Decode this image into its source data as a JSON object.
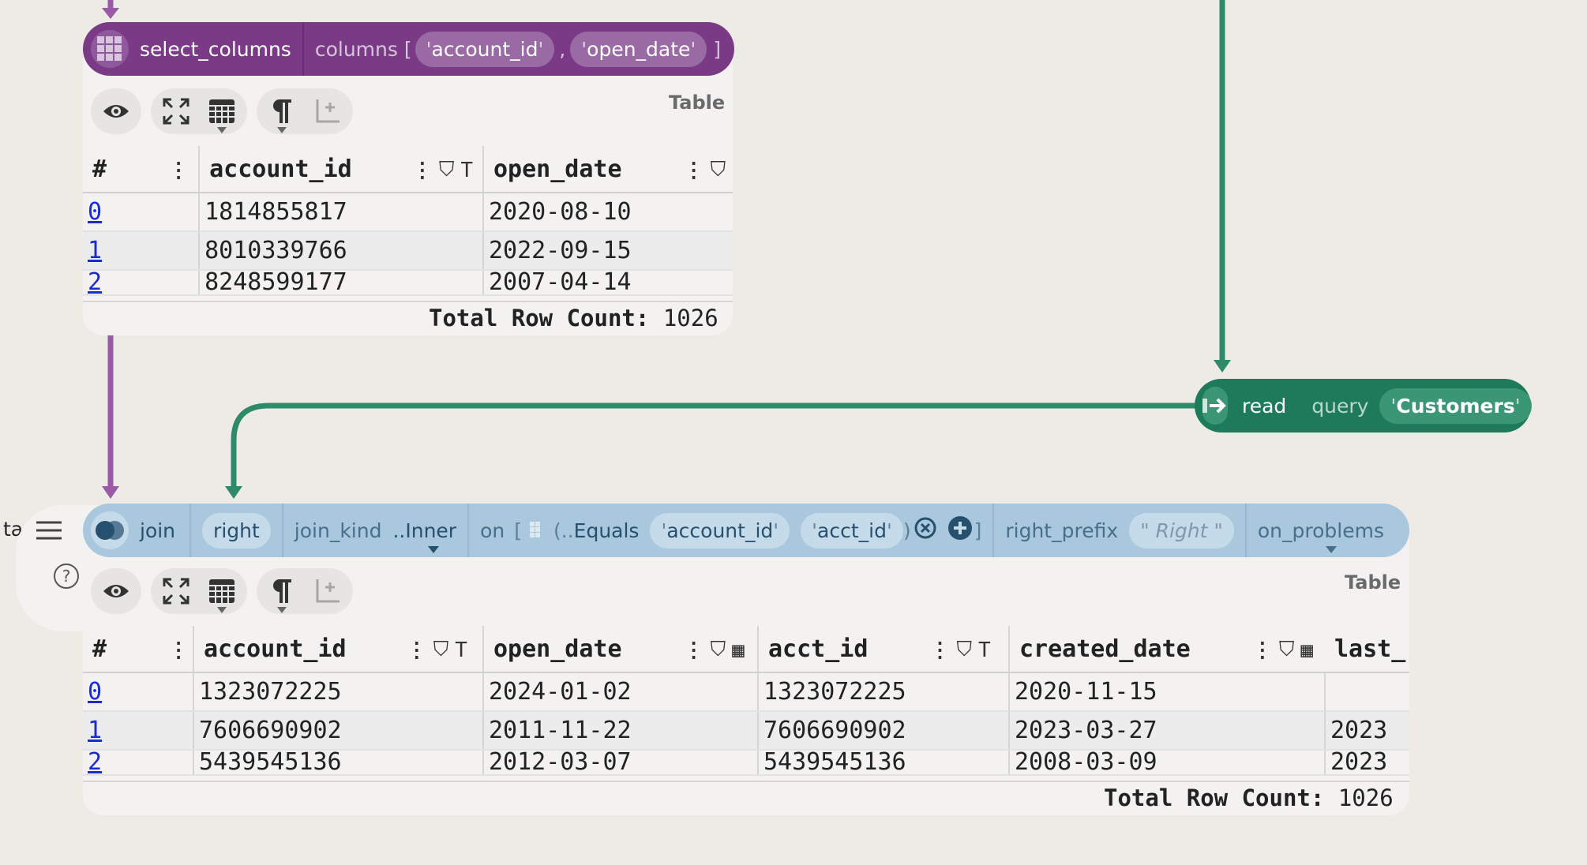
{
  "colors": {
    "select_node": "#7a3a86",
    "read_node": "#1d7a5a",
    "join_node": "#a9c8de",
    "edge_purple": "#9a5aa6",
    "edge_green": "#2e8b6a"
  },
  "select_node": {
    "name": "select_columns",
    "arg_label": "columns",
    "open_bracket": "[",
    "col1": "account_id",
    "comma": ",",
    "col2": "open_date",
    "close_bracket": "]",
    "icon": "grid-icon"
  },
  "read_node": {
    "name": "read",
    "arg_label": "query",
    "value": "Customers",
    "icon": "arrow-right-icon"
  },
  "join_node": {
    "name": "join",
    "right_arg": "right",
    "join_kind_label": "join_kind",
    "join_kind_value": "..Inner",
    "on_label": "on",
    "on_bracket_open": "[",
    "equals_prefix": "(..",
    "equals_label": "Equals",
    "on_col1": "account_id",
    "on_col2": "acct_id",
    "on_paren_close": ")",
    "on_bracket_close": "]",
    "right_prefix_label": "right_prefix",
    "right_prefix_value": "Right",
    "on_problems_label": "on_problems",
    "icon": "join-icon"
  },
  "left_fragment": "ta",
  "viz_label": "Table",
  "table1": {
    "columns": [
      "#",
      "account_id",
      "open_date"
    ],
    "rows": [
      [
        "0",
        "1814855817",
        "2020-08-10"
      ],
      [
        "1",
        "8010339766",
        "2022-09-15"
      ],
      [
        "2",
        "8248599177",
        "2007-04-14"
      ]
    ],
    "row_count_label": "Total Row Count:",
    "row_count": "1026"
  },
  "table2": {
    "columns": [
      "#",
      "account_id",
      "open_date",
      "acct_id",
      "created_date",
      "last_"
    ],
    "rows": [
      [
        "0",
        "1323072225",
        "2024-01-02",
        "1323072225",
        "2020-11-15",
        ""
      ],
      [
        "1",
        "7606690902",
        "2011-11-22",
        "7606690902",
        "2023-03-27",
        "2023"
      ],
      [
        "2",
        "5439545136",
        "2012-03-07",
        "5439545136",
        "2008-03-09",
        "2023"
      ]
    ],
    "row_count_label": "Total Row Count:",
    "row_count": "1026"
  }
}
